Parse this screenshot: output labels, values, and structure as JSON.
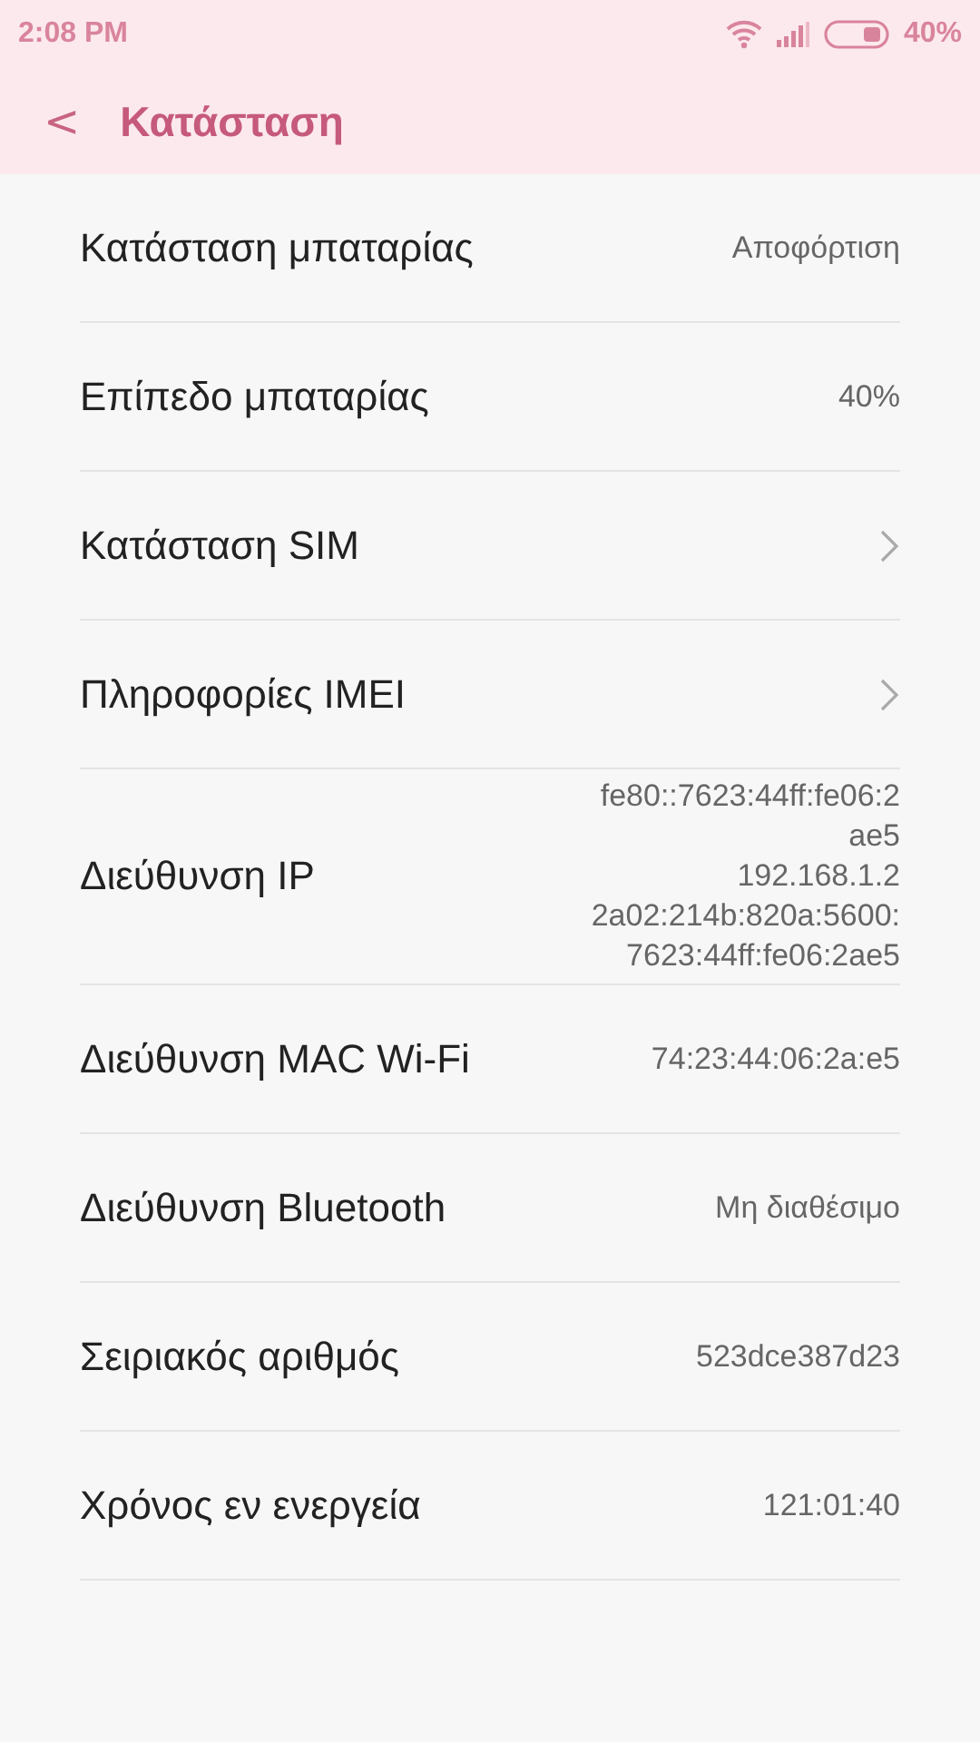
{
  "status_bar": {
    "time": "2:08 PM",
    "battery": "40%"
  },
  "header": {
    "back": "<",
    "title": "Κατάσταση"
  },
  "rows": [
    {
      "kind": "value",
      "label": "Κατάσταση μπαταρίας",
      "value": [
        "Αποφόρτιση"
      ]
    },
    {
      "kind": "value",
      "label": "Επίπεδο μπαταρίας",
      "value": [
        "40%"
      ]
    },
    {
      "kind": "link",
      "label": "Κατάσταση SIM"
    },
    {
      "kind": "link",
      "label": "Πληροφορίες IMEI"
    },
    {
      "kind": "value",
      "label": "Διεύθυνση IP",
      "value": [
        "fe80::7623:44ff:fe06:2",
        "ae5",
        "192.168.1.2",
        "2a02:214b:820a:5600:",
        "7623:44ff:fe06:2ae5"
      ]
    },
    {
      "kind": "value",
      "label": "Διεύθυνση MAC Wi-Fi",
      "value": [
        "74:23:44:06:2a:e5"
      ]
    },
    {
      "kind": "value",
      "label": "Διεύθυνση Bluetooth",
      "value": [
        "Μη διαθέσιμο"
      ]
    },
    {
      "kind": "value",
      "label": "Σειριακός αριθμός",
      "value": [
        "523dce387d23"
      ]
    },
    {
      "kind": "value",
      "label": "Χρόνος εν ενεργεία",
      "value": [
        "121:01:40"
      ]
    }
  ]
}
